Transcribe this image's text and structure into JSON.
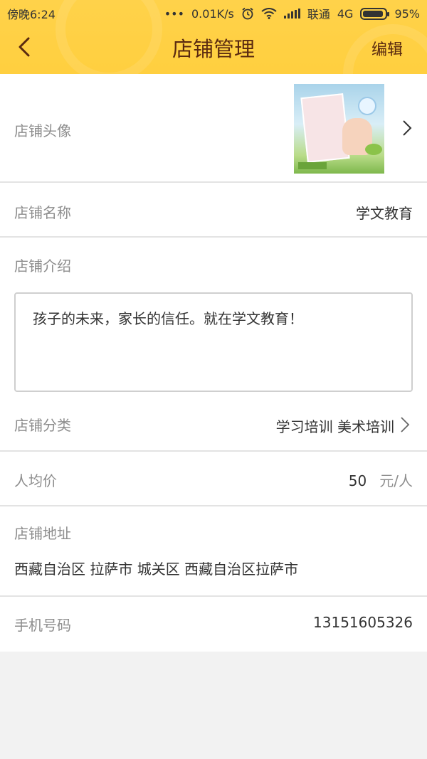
{
  "status_bar": {
    "time": "傍晚6:24",
    "dots": "•••",
    "speed": "0.01K/s",
    "carrier": "联通",
    "network": "4G",
    "battery": "95%"
  },
  "nav": {
    "title": "店铺管理",
    "edit_label": "编辑"
  },
  "store": {
    "avatar_label": "店铺头像",
    "name_label": "店铺名称",
    "name_value": "学文教育",
    "intro_label": "店铺介绍",
    "intro_value": "孩子的未来，家长的信任。就在学文教育！",
    "category_label": "店铺分类",
    "category_value": "学习培训 美术培训",
    "price_label": "人均价",
    "price_value": "50",
    "price_unit": "元/人",
    "address_label": "店铺地址",
    "address_value": "西藏自治区 拉萨市 城关区 西藏自治区拉萨市",
    "phone_label": "手机号码",
    "phone_value": "13151605326"
  },
  "colors": {
    "header": "#ffd24a",
    "title_text": "#5a2a10",
    "label_text": "#8d8d8d",
    "value_text": "#333333",
    "divider": "#e3e3e3",
    "page_bg": "#f2f2f2"
  }
}
